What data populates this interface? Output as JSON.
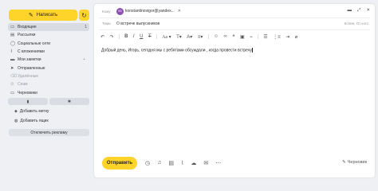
{
  "sidebar": {
    "compose_label": "Написать",
    "folders": [
      {
        "label": "Входящие",
        "count": "1",
        "icon": "inbox-icon",
        "glyph": "▭"
      },
      {
        "label": "Рассылки",
        "count": "",
        "icon": "newsletter-icon",
        "glyph": "▤"
      },
      {
        "label": "Социальные сети",
        "count": "",
        "icon": "social-icon",
        "glyph": "◯"
      },
      {
        "label": "С вложениями",
        "count": "",
        "icon": "attachment-icon",
        "glyph": "⌇"
      },
      {
        "label": "Мои заметки",
        "count": "",
        "icon": "folder-icon",
        "glyph": "▬"
      },
      {
        "label": "Отправленные",
        "count": "",
        "icon": "sent-icon",
        "glyph": "➤"
      },
      {
        "label": "Удалённые",
        "count": "",
        "icon": "trash-icon",
        "glyph": "🗑"
      },
      {
        "label": "Спам",
        "count": "",
        "icon": "spam-icon",
        "glyph": "⊘"
      },
      {
        "label": "Черновики",
        "count": "",
        "icon": "drafts-icon",
        "glyph": "▭"
      }
    ],
    "add_label": "Добавить метку",
    "add_folder": "Добавить ящик",
    "disable_ads": "Отключить рекламу"
  },
  "compose": {
    "from_label": "Кому",
    "avatar_initials": "КВ",
    "from_email": "konstantinovigor@yandex...",
    "subject_label": "Тема",
    "subject_value": "О встрече выпускников",
    "cc_label": "Копия, От кого",
    "body": "Добрый день, Игорь, сегодня мы с ребятами обсуждали , когда провести встречу",
    "send_label": "Отправить",
    "drafts_label": "Черновик"
  }
}
